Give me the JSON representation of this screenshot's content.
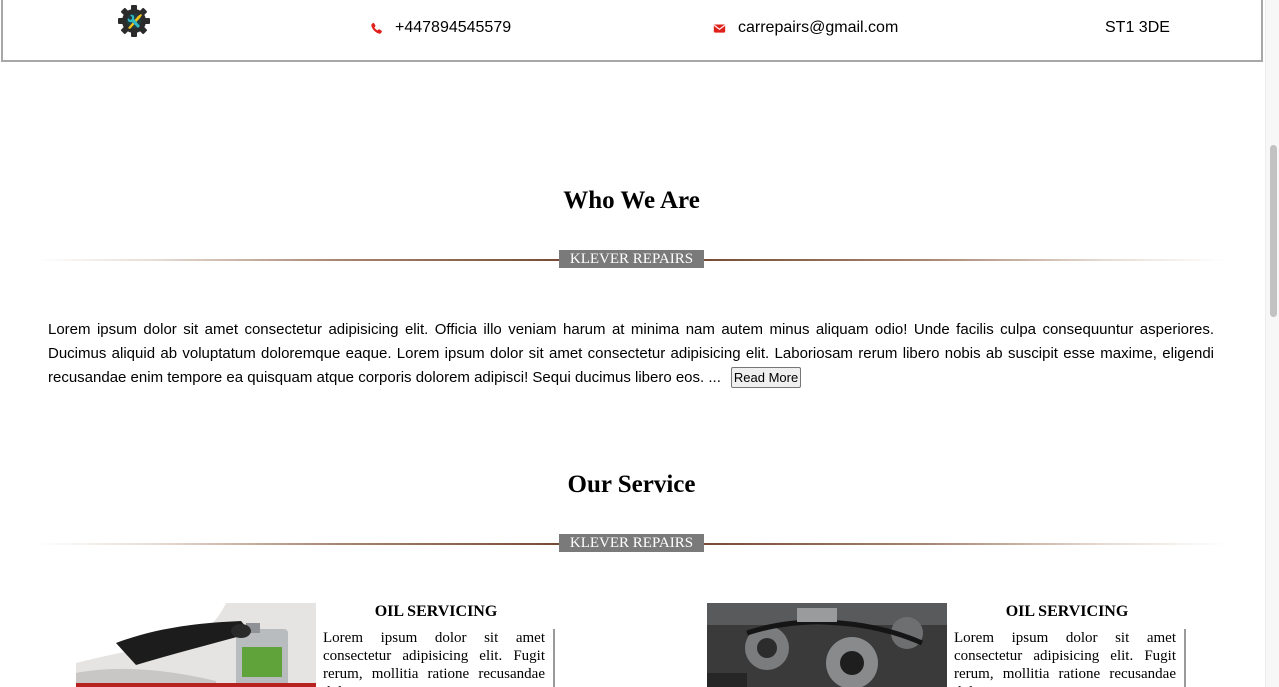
{
  "header": {
    "logo_icon": "gear-wrench-logo-icon",
    "phone": {
      "icon": "phone-icon",
      "text": "+447894545579"
    },
    "email": {
      "icon": "envelope-icon",
      "text": "carrepairs@gmail.com"
    },
    "postcode": "ST1 3DE"
  },
  "about": {
    "title": "Who We Are",
    "tag": "KLEVER REPAIRS",
    "text": "Lorem ipsum dolor sit amet consectetur adipisicing elit. Officia illo veniam harum at minima nam autem minus aliquam odio! Unde facilis culpa consequuntur asperiores. Ducimus aliquid ab voluptatum doloremque eaque. Lorem ipsum dolor sit amet consectetur adipisicing elit. Laboriosam rerum libero nobis ab suscipit esse maxime, eligendi recusandae enim tempore ea quisquam atque corporis dolorem adipisci! Sequi ducimus libero eos. ...",
    "read_more_label": "Read More"
  },
  "services": {
    "title": "Our Service",
    "tag": "KLEVER REPAIRS",
    "cards": [
      {
        "title": "OIL SERVICING",
        "text": "Lorem ipsum dolor sit amet consectetur adipisicing elit. Fugit rerum, mollitia ratione recusandae dolores"
      },
      {
        "title": "OIL SERVICING",
        "text": "Lorem ipsum dolor sit amet consectetur adipisicing elit. Fugit rerum, mollitia ratione recusandae dolores"
      }
    ]
  },
  "colors": {
    "accent_red": "#e0201b",
    "tag_bg": "#7a7a7a",
    "divider_center": "#6b3f29"
  }
}
